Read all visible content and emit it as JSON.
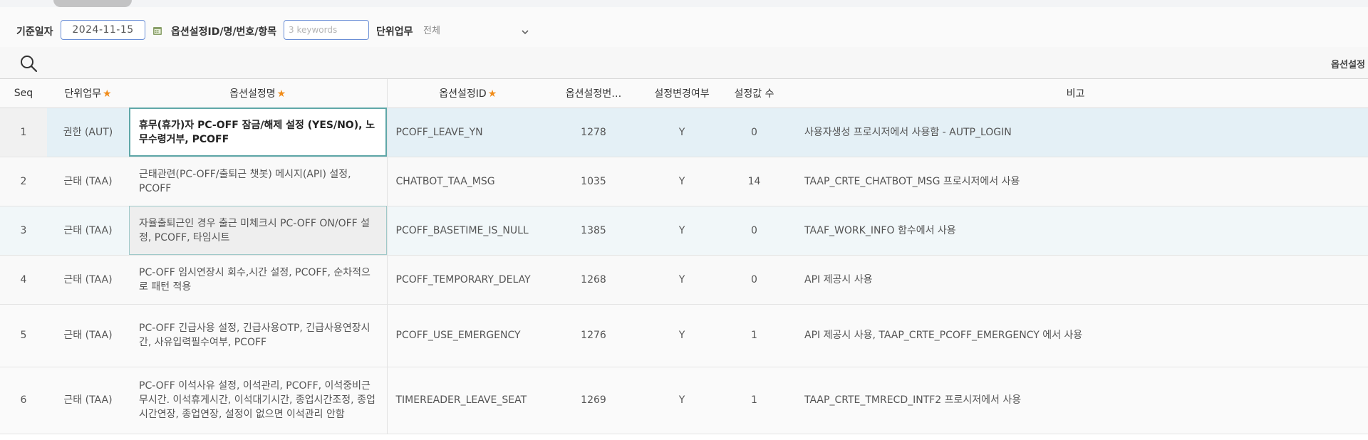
{
  "filters": {
    "base_date_label": "기준일자",
    "base_date_value": "2024-11-15",
    "option_search_label": "옵션설정ID/명/번호/항목",
    "keyword_placeholder": "3 keywords",
    "unit_label": "단위업무",
    "unit_value": "전체"
  },
  "toolbar": {
    "right_label": "옵션설정"
  },
  "icons": {
    "calendar": "calendar-icon",
    "search": "search-icon",
    "chevron": "chevron-down-icon"
  },
  "colors": {
    "accent_border": "#6b8fd6",
    "required_star": "#f08c1a",
    "selected_row": "#e4f0f6",
    "focus_cell": "#5fa7a8"
  },
  "table": {
    "headers": {
      "seq": "Seq",
      "unit": "단위업무",
      "name": "옵션설정명",
      "id": "옵션설정ID",
      "no": "옵션설정번…",
      "changed": "설정변경여부",
      "count": "설정값 수",
      "note": "비고"
    },
    "required_mark": "★",
    "rows": [
      {
        "seq": "1",
        "unit": "권한 (AUT)",
        "name": "휴무(휴가)자 PC-OFF 잠금/해제 설정 (YES/NO), 노무수령거부, PCOFF",
        "id": "PCOFF_LEAVE_YN",
        "no": "1278",
        "changed": "Y",
        "count": "0",
        "note": "사용자생성 프로시저에서 사용함 - AUTP_LOGIN"
      },
      {
        "seq": "2",
        "unit": "근태 (TAA)",
        "name": "근태관련(PC-OFF/출퇴근 챗봇) 메시지(API) 설정, PCOFF",
        "id": "CHATBOT_TAA_MSG",
        "no": "1035",
        "changed": "Y",
        "count": "14",
        "note": "TAAP_CRTE_CHATBOT_MSG 프로시저에서 사용"
      },
      {
        "seq": "3",
        "unit": "근태 (TAA)",
        "name": "자율출퇴근인 경우 출근 미체크시 PC-OFF ON/OFF 설정, PCOFF, 타임시트",
        "id": "PCOFF_BASETIME_IS_NULL",
        "no": "1385",
        "changed": "Y",
        "count": "0",
        "note": "TAAF_WORK_INFO 함수에서 사용"
      },
      {
        "seq": "4",
        "unit": "근태 (TAA)",
        "name": "PC-OFF 임시연장시 회수,시간 설정, PCOFF, 순차적으로 패턴 적용",
        "id": "PCOFF_TEMPORARY_DELAY",
        "no": "1268",
        "changed": "Y",
        "count": "0",
        "note": "API 제공시 사용"
      },
      {
        "seq": "5",
        "unit": "근태 (TAA)",
        "name": "PC-OFF 긴급사용 설정, 긴급사용OTP, 긴급사용연장시간, 사유입력필수여부, PCOFF",
        "id": "PCOFF_USE_EMERGENCY",
        "no": "1276",
        "changed": "Y",
        "count": "1",
        "note": "API 제공시 사용, TAAP_CRTE_PCOFF_EMERGENCY 에서 사용"
      },
      {
        "seq": "6",
        "unit": "근태 (TAA)",
        "name": "PC-OFF 이석사유 설정, 이석관리, PCOFF, 이석중비근무시간. 이석휴게시간, 이석대기시간, 종업시간조정, 종업시간연장, 종업연장, 설정이 없으면 이석관리 안함",
        "id": "TIMEREADER_LEAVE_SEAT",
        "no": "1269",
        "changed": "Y",
        "count": "1",
        "note": "TAAP_CRTE_TMRECD_INTF2 프로시저에서 사용"
      }
    ]
  }
}
